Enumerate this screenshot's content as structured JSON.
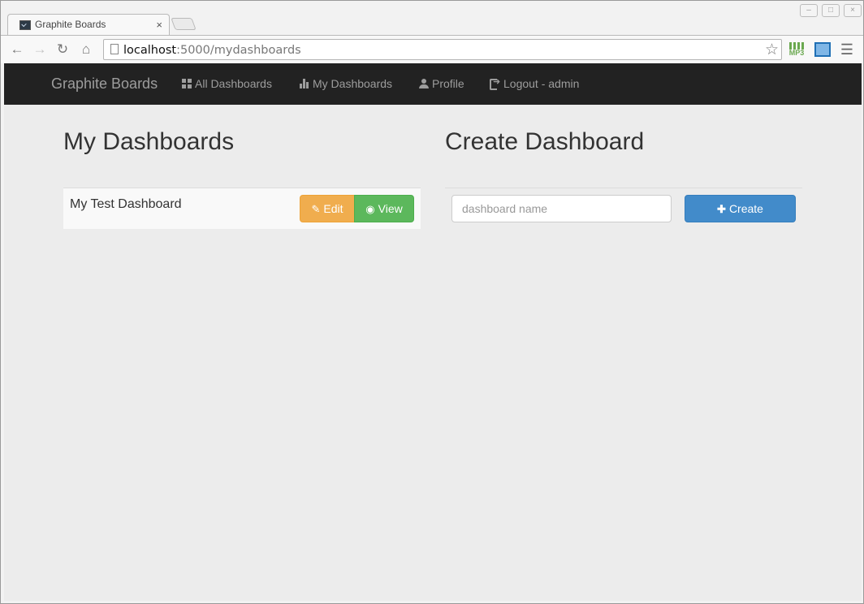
{
  "browser": {
    "tab_title": "Graphite Boards",
    "tab_close": "×",
    "url_host": "localhost",
    "url_path": ":5000/mydashboards",
    "window_controls": [
      "–",
      "□",
      "×"
    ]
  },
  "navbar": {
    "brand": "Graphite Boards",
    "links": [
      {
        "label": "All Dashboards",
        "icon": "grid-icon"
      },
      {
        "label": "My Dashboards",
        "icon": "bar-chart-icon"
      },
      {
        "label": "Profile",
        "icon": "user-icon"
      },
      {
        "label": "Logout - admin",
        "icon": "logout-icon"
      }
    ]
  },
  "my_dashboards": {
    "heading": "My Dashboards",
    "items": [
      {
        "name": "My Test Dashboard",
        "edit_label": "Edit",
        "view_label": "View"
      }
    ]
  },
  "create_dashboard": {
    "heading": "Create Dashboard",
    "input_placeholder": "dashboard name",
    "input_value": "",
    "create_label": "Create"
  },
  "colors": {
    "navbar_bg": "#222222",
    "edit": "#f0ad4e",
    "view": "#5cb85c",
    "create": "#428bca",
    "page_bg": "#ececec"
  }
}
